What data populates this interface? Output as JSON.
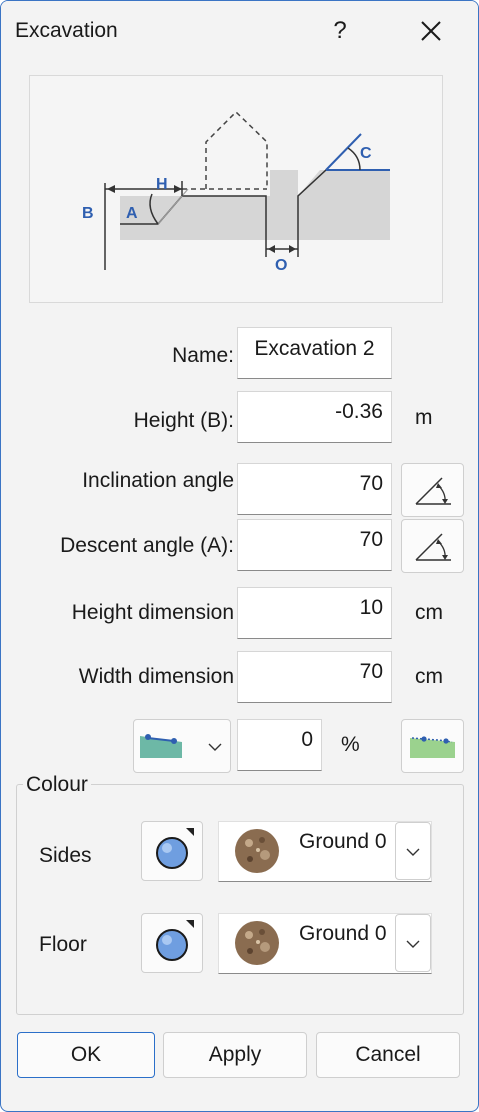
{
  "window": {
    "title": "Excavation",
    "help_glyph": "?"
  },
  "diagram": {
    "labels": {
      "b": "B",
      "a": "A",
      "h": "H",
      "c": "C",
      "o": "O"
    },
    "accent_color": "#2f5fb0"
  },
  "form": {
    "name": {
      "label": "Name:",
      "value": "Excavation 2"
    },
    "height": {
      "label": "Height (B):",
      "value": "-0.36",
      "unit": "m"
    },
    "inclination": {
      "label": "Inclination angle",
      "value": "70",
      "icon": "angle-icon"
    },
    "descent": {
      "label": "Descent angle (A):",
      "value": "70",
      "icon": "angle-icon"
    },
    "height_dimension": {
      "label": "Height dimension",
      "value": "10",
      "unit": "cm"
    },
    "width_dimension": {
      "label": "Width dimension",
      "value": "70",
      "unit": "cm"
    },
    "slope": {
      "value": "0",
      "unit": "%",
      "icon": "terrain-slope-icon"
    }
  },
  "colour": {
    "group_label": "Colour",
    "sides": {
      "label": "Sides",
      "material": "Ground 0"
    },
    "floor": {
      "label": "Floor",
      "material": "Ground 0"
    }
  },
  "buttons": {
    "ok": "OK",
    "apply": "Apply",
    "cancel": "Cancel"
  }
}
